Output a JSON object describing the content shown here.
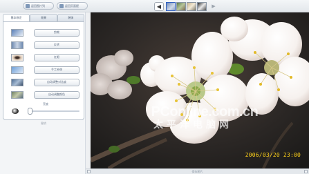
{
  "toolbar": {
    "back_label": "返回图片列",
    "save_label": "返回页面提",
    "nav_prev": "◀",
    "nav_next": "▶",
    "thumbnails": [
      "thumb-1",
      "thumb-2",
      "thumb-3",
      "thumb-4"
    ]
  },
  "sidebar": {
    "tabs": [
      {
        "label": "基本修正",
        "active": true
      },
      {
        "label": "效果",
        "active": false
      },
      {
        "label": "装饰",
        "active": false
      }
    ],
    "tools": [
      {
        "label": "剪裁"
      },
      {
        "label": "反转"
      },
      {
        "label": "红眼"
      },
      {
        "label": "手工补偿"
      },
      {
        "label": "自动调整对比度"
      },
      {
        "label": "自动调整颜色"
      }
    ],
    "slider_label": "亮度",
    "slider_level": 0.0,
    "footer_label": "撤销"
  },
  "photo": {
    "date_stamp": "2006/03/20  23:00",
    "watermark_main": "PConline.com.cn",
    "watermark_sub": "太平洋电脑网"
  },
  "statusbar": {
    "label": "保存图片"
  },
  "colors": {
    "stamp": "#ffd21a",
    "accent": "#3060c0"
  }
}
